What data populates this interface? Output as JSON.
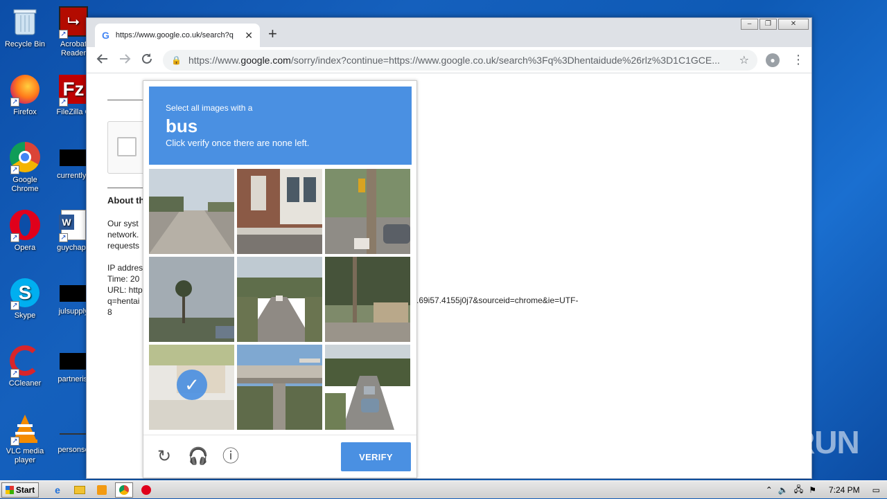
{
  "desktop": {
    "icons": [
      {
        "label": "Recycle Bin"
      },
      {
        "label": "Acrobat Reader"
      },
      {
        "label": "Firefox"
      },
      {
        "label": "FileZilla C"
      },
      {
        "label": "Google Chrome"
      },
      {
        "label": "currentlys"
      },
      {
        "label": "Opera"
      },
      {
        "label": "guychapb"
      },
      {
        "label": "Skype"
      },
      {
        "label": "julsupply"
      },
      {
        "label": "CCleaner"
      },
      {
        "label": "partnerisi"
      },
      {
        "label": "VLC media player"
      },
      {
        "label": "personse"
      }
    ]
  },
  "browser": {
    "tab_title": "https://www.google.co.uk/search?q",
    "address": {
      "prefix": "https://www.",
      "domain": "google.com",
      "path": "/sorry/index?continue=https://www.google.co.uk/search%3Fq%3Dhentaidude%26rlz%3D1C1GCE..."
    }
  },
  "page": {
    "about_heading": "About th",
    "paragraph_lines": [
      "Our syst",
      "network.",
      "requests"
    ],
    "info_lines": [
      "IP addres",
      "Time: 20",
      "URL: http",
      "q=hentai",
      "8"
    ],
    "url_tail": ".69i57.4155j0j7&sourceid=chrome&ie=UTF-"
  },
  "captcha": {
    "instruction_small": "Select all images with a",
    "target_word": "bus",
    "instruction_sub": "Click verify once there are none left.",
    "verify_label": "VERIFY",
    "selected_tiles": [
      6
    ]
  },
  "taskbar": {
    "start_label": "Start",
    "clock": "7:24 PM"
  },
  "watermark": "ANY RUN"
}
